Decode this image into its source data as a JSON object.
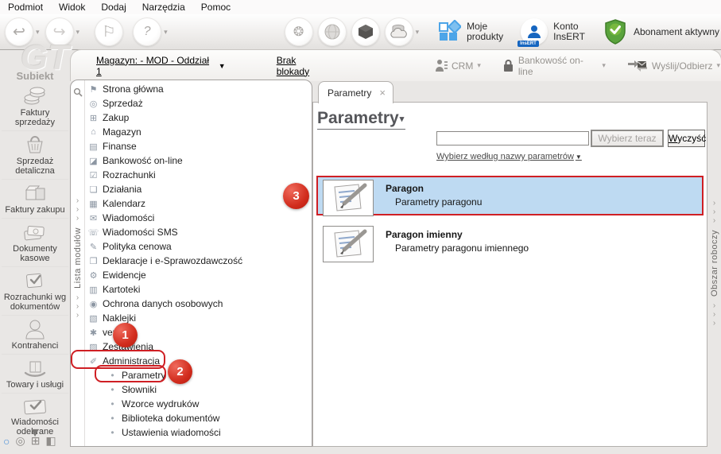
{
  "icons": {
    "caret_down": "▾",
    "down_arrow": "▼",
    "chevron": "›",
    "close": "×",
    "bullet": "•",
    "back": "↩",
    "forward": "↪",
    "flag": "⚐",
    "help": "?",
    "gear_dots": "❂",
    "mini_circle": "○",
    "mini_coins": "◎",
    "mini_grid": "⊞",
    "mini_box": "◧"
  },
  "menubar": {
    "items": [
      "Podmiot",
      "Widok",
      "Dodaj",
      "Narzędzia",
      "Pomoc"
    ]
  },
  "toolbar": {
    "moje_produkty": {
      "line1": "Moje",
      "line2": "produkty"
    },
    "konto": {
      "line1": "Konto",
      "line2": "InsERT",
      "badge": "InsERT"
    },
    "abonament": {
      "label": "Abonament aktywny"
    }
  },
  "statusbar": {
    "magazyn": "Magazyn: - MOD - Oddział 1",
    "blokada": "Brak blokady",
    "crm": "CRM",
    "bankowosc": "Bankowość on-line",
    "wyslij": "Wyślij/Odbierz"
  },
  "branding": {
    "logo": "GT",
    "app": "Subiekt"
  },
  "sidebar": {
    "items": [
      {
        "label": "Faktury sprzedaży",
        "icon": "sales-invoices-icon"
      },
      {
        "label": "Sprzedaż detaliczna",
        "icon": "retail-sales-icon"
      },
      {
        "label": "Faktury zakupu",
        "icon": "purchase-invoices-icon"
      },
      {
        "label": "Dokumenty kasowe",
        "icon": "cash-documents-icon"
      },
      {
        "label": "Rozrachunki wg dokumentów",
        "icon": "settlements-icon"
      },
      {
        "label": "Kontrahenci",
        "icon": "contractors-icon"
      },
      {
        "label": "Towary i usługi",
        "icon": "goods-services-icon"
      },
      {
        "label": "Wiadomości odebrane",
        "icon": "inbox-icon"
      }
    ]
  },
  "module_list": {
    "vertical_label": "Lista modułów",
    "items": [
      {
        "label": "Strona główna",
        "glyph": "⚑"
      },
      {
        "label": "Sprzedaż",
        "glyph": "◎"
      },
      {
        "label": "Zakup",
        "glyph": "⊞"
      },
      {
        "label": "Magazyn",
        "glyph": "⌂"
      },
      {
        "label": "Finanse",
        "glyph": "▤"
      },
      {
        "label": "Bankowość on-line",
        "glyph": "◪"
      },
      {
        "label": "Rozrachunki",
        "glyph": "☑"
      },
      {
        "label": "Działania",
        "glyph": "❏"
      },
      {
        "label": "Kalendarz",
        "glyph": "▦"
      },
      {
        "label": "Wiadomości",
        "glyph": "✉"
      },
      {
        "label": "Wiadomości SMS",
        "glyph": "☏"
      },
      {
        "label": "Polityka cenowa",
        "glyph": "✎"
      },
      {
        "label": "Deklaracje i e-Sprawozdawczość",
        "glyph": "❒"
      },
      {
        "label": "Ewidencje",
        "glyph": "⚙"
      },
      {
        "label": "Kartoteki",
        "glyph": "▥"
      },
      {
        "label": "Ochrona danych osobowych",
        "glyph": "◉"
      },
      {
        "label": "Naklejki",
        "glyph": "▧"
      },
      {
        "label": "vendero",
        "glyph": "✱"
      },
      {
        "label": "Zestawienia",
        "glyph": "▨"
      },
      {
        "label": "Administracja",
        "glyph": "✐"
      },
      {
        "label": "Parametry",
        "glyph": "•"
      },
      {
        "label": "Słowniki",
        "glyph": "•"
      },
      {
        "label": "Wzorce wydruków",
        "glyph": "•"
      },
      {
        "label": "Biblioteka dokumentów",
        "glyph": "•"
      },
      {
        "label": "Ustawienia wiadomości",
        "glyph": "•"
      }
    ]
  },
  "workspace_panel": {
    "vertical_label": "Obszar roboczy"
  },
  "content": {
    "tab_label": "Parametry",
    "title": "Parametry",
    "search_value": "",
    "select_button": "Wybierz teraz",
    "clear_button": "Wyczyść",
    "filter_link": "Wybierz według nazwy parametrów",
    "items": [
      {
        "title": "Paragon",
        "desc": "Parametry paragonu"
      },
      {
        "title": "Paragon imienny",
        "desc": "Parametry paragonu imiennego"
      }
    ]
  },
  "annotations": {
    "steps": [
      "1",
      "2",
      "3"
    ]
  },
  "colors": {
    "selection_bg": "#bedaf2",
    "annotation_red": "#cf1f24",
    "accent_blue": "#4da5e8",
    "shield_green": "#5aa33c"
  }
}
